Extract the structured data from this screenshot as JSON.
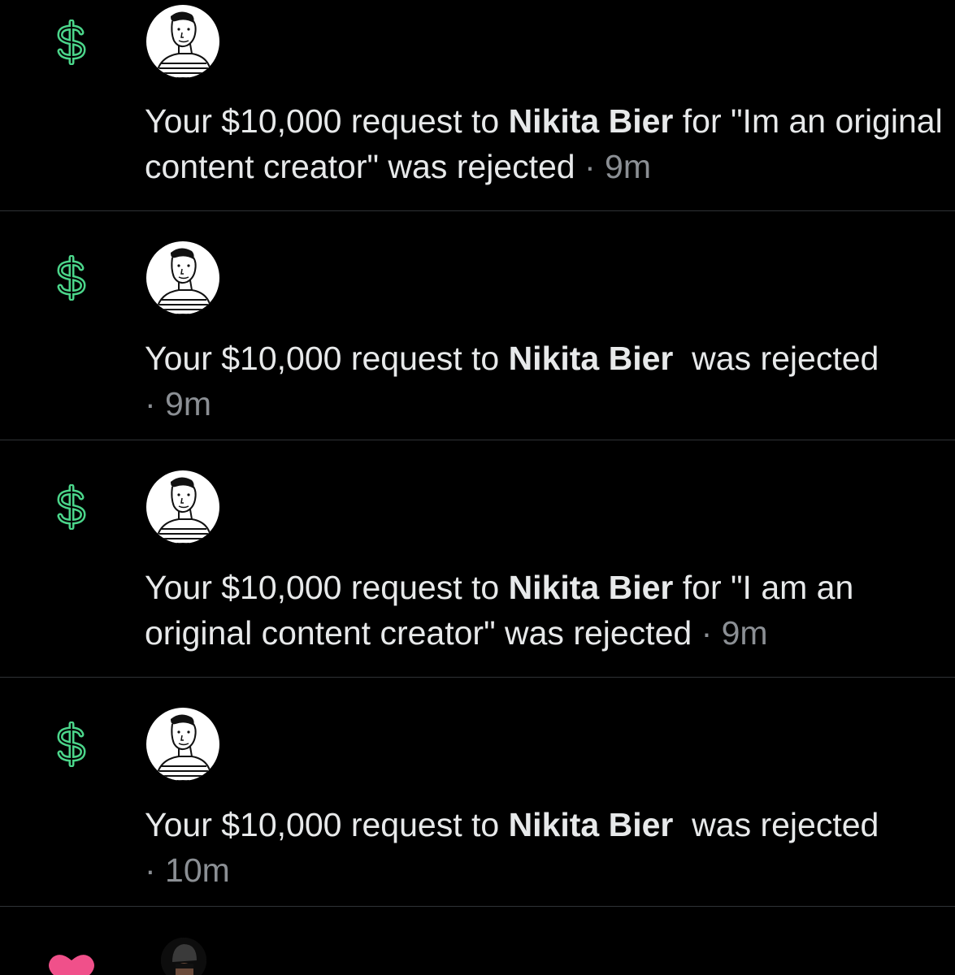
{
  "colors": {
    "background": "#000000",
    "text": "#e7e9ea",
    "muted": "#8b8f94",
    "dollar_icon": "#4bd58a",
    "heart_icon": "#f0508a",
    "divider": "#2f3336"
  },
  "notifications": [
    {
      "icon": "dollar-icon",
      "prefix": "Your $10,000 request to ",
      "name": "Nikita Bier",
      "suffix": " for \"Im an original content creator\" was rejected",
      "time": "9m"
    },
    {
      "icon": "dollar-icon",
      "prefix": "Your $10,000 request to ",
      "name": "Nikita Bier",
      "suffix": "  was rejected",
      "time": "9m"
    },
    {
      "icon": "dollar-icon",
      "prefix": "Your $10,000 request to ",
      "name": "Nikita Bier",
      "suffix": " for \"I am an original content creator\" was rejected",
      "time": "9m"
    },
    {
      "icon": "dollar-icon",
      "prefix": "Your $10,000 request to ",
      "name": "Nikita Bier",
      "suffix": "  was rejected",
      "time": "10m"
    },
    {
      "icon": "heart-icon"
    }
  ],
  "separator": " · "
}
